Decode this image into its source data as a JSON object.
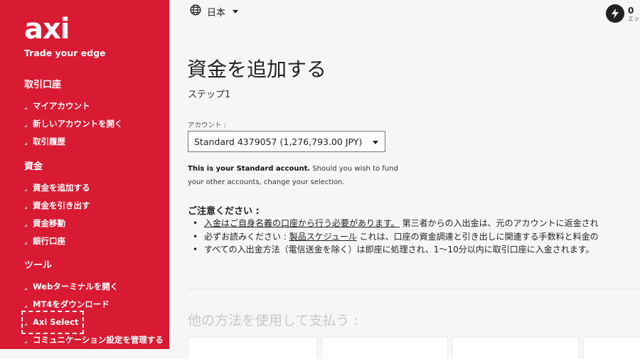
{
  "brand": {
    "logo_text": "axi",
    "tagline": "Trade your edge"
  },
  "sidebar": {
    "sections": [
      {
        "heading": "取引口座",
        "items": [
          "マイアカウント",
          "新しいアカウントを開く",
          "取引履歴"
        ]
      },
      {
        "heading": "資金",
        "items": [
          "資金を追加する",
          "資金を引き出す",
          "資金移動",
          "銀行口座"
        ]
      },
      {
        "heading": "ツール",
        "items": [
          "Webターミナルを開く",
          "MT4をダウンロード",
          "Axi Select",
          "コミュニケーション設定を管理する"
        ]
      }
    ]
  },
  "header": {
    "language": "日本",
    "badge_count": "0",
    "badge_sub": "エッ"
  },
  "main": {
    "title": "資金を追加する",
    "step": "ステップ1",
    "account_label": "アカウント :",
    "account_value": "Standard 4379057 (1,276,793.00 JPY)",
    "info_bold": "This is your Standard account.",
    "info_rest": " Should you wish to fund your other accounts, change your selection.",
    "notice_title": "ご注意ください :",
    "notices": [
      {
        "link": "入金はご自身名義の口座から行う必要があります。",
        "text": " 第三者からの入出金は、元のアカウントに返金され"
      },
      {
        "pre": "必ずお読みください : ",
        "link": "製品スケジュール",
        "text": " これは、口座の資金調達と引き出しに関連する手数料と料金の"
      },
      {
        "text": "すべての入出金方法（電信送金を除く）は即座に処理され、1〜10分以内に取引口座に入金されます。"
      }
    ],
    "other_methods": "他の方法を使用して支払う :"
  },
  "colors": {
    "sidebar_bg": "#d81a33",
    "page_bg": "#f6f6f6"
  }
}
